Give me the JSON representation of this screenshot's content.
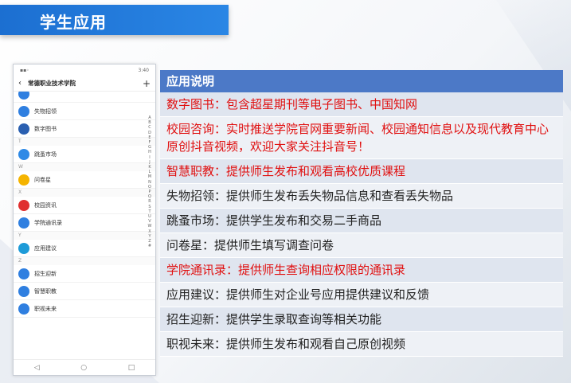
{
  "header": {
    "title": "学生应用"
  },
  "phone": {
    "status_time": "3:40",
    "page_title": "常德职业技术学院",
    "back_glyph": "‹",
    "plus_glyph": "+",
    "items": [
      {
        "type": "app",
        "name": "",
        "icon": "app-icon",
        "color": "#2f7fe0"
      },
      {
        "type": "app",
        "name": "失物招领",
        "icon": "search-person-icon",
        "color": "#2f7fe0"
      },
      {
        "type": "app",
        "name": "数字图书",
        "icon": "book-icon",
        "color": "#2a5fb0"
      },
      {
        "type": "letter",
        "name": "T"
      },
      {
        "type": "app",
        "name": "跳蚤市场",
        "icon": "shop-icon",
        "color": "#2f8ae6"
      },
      {
        "type": "letter",
        "name": "W"
      },
      {
        "type": "app",
        "name": "问卷星",
        "icon": "star-icon",
        "color": "#f5b400"
      },
      {
        "type": "letter",
        "name": "X"
      },
      {
        "type": "app",
        "name": "校园资讯",
        "icon": "news-icon",
        "color": "#e03030"
      },
      {
        "type": "app",
        "name": "学院通讯录",
        "icon": "contacts-icon",
        "color": "#2f7fe0"
      },
      {
        "type": "letter",
        "name": "Y"
      },
      {
        "type": "app",
        "name": "应用建议",
        "icon": "suggest-icon",
        "color": "#1e9bd8"
      },
      {
        "type": "letter",
        "name": "Z"
      },
      {
        "type": "app",
        "name": "招生迎新",
        "icon": "enroll-icon",
        "color": "#2f7fe0"
      },
      {
        "type": "app",
        "name": "智慧职教",
        "icon": "education-icon",
        "color": "#2f7fe0"
      },
      {
        "type": "app",
        "name": "职视未来",
        "icon": "video-icon",
        "color": "#2f7fe0"
      }
    ],
    "alphabet": [
      "A",
      "B",
      "C",
      "D",
      "E",
      "F",
      "G",
      "H",
      "I",
      "J",
      "K",
      "L",
      "M",
      "N",
      "O",
      "P",
      "Q",
      "R",
      "S",
      "T",
      "U",
      "V",
      "W",
      "X",
      "Y",
      "Z",
      "#"
    ],
    "softkeys": [
      "◁",
      "○",
      "□"
    ]
  },
  "table": {
    "header": "应用说明",
    "rows": [
      {
        "text": "数字图书：包含超星期刊等电子图书、中国知网",
        "red": true
      },
      {
        "text": "校园咨询：实时推送学院官网重要新闻、校园通知信息以及现代教育中心原创抖音视频，欢迎大家关注抖音号！",
        "red": true
      },
      {
        "text": "智慧职教：提供师生发布和观看高校优质课程",
        "red": true
      },
      {
        "text": "失物招领：提供师生发布丢失物品信息和查看丢失物品",
        "red": false
      },
      {
        "text": "跳蚤市场：提供学生发布和交易二手商品",
        "red": false
      },
      {
        "text": "问卷星：提供师生填写调查问卷",
        "red": false
      },
      {
        "text": "学院通讯录：提供师生查询相应权限的通讯录",
        "red": true
      },
      {
        "text": "应用建议：提供师生对企业号应用提供建议和反馈",
        "red": false
      },
      {
        "text": "招生迎新：提供学生录取查询等相关功能",
        "red": false
      },
      {
        "text": "职视未来：提供师生发布和观看自己原创视频",
        "red": false
      }
    ]
  }
}
